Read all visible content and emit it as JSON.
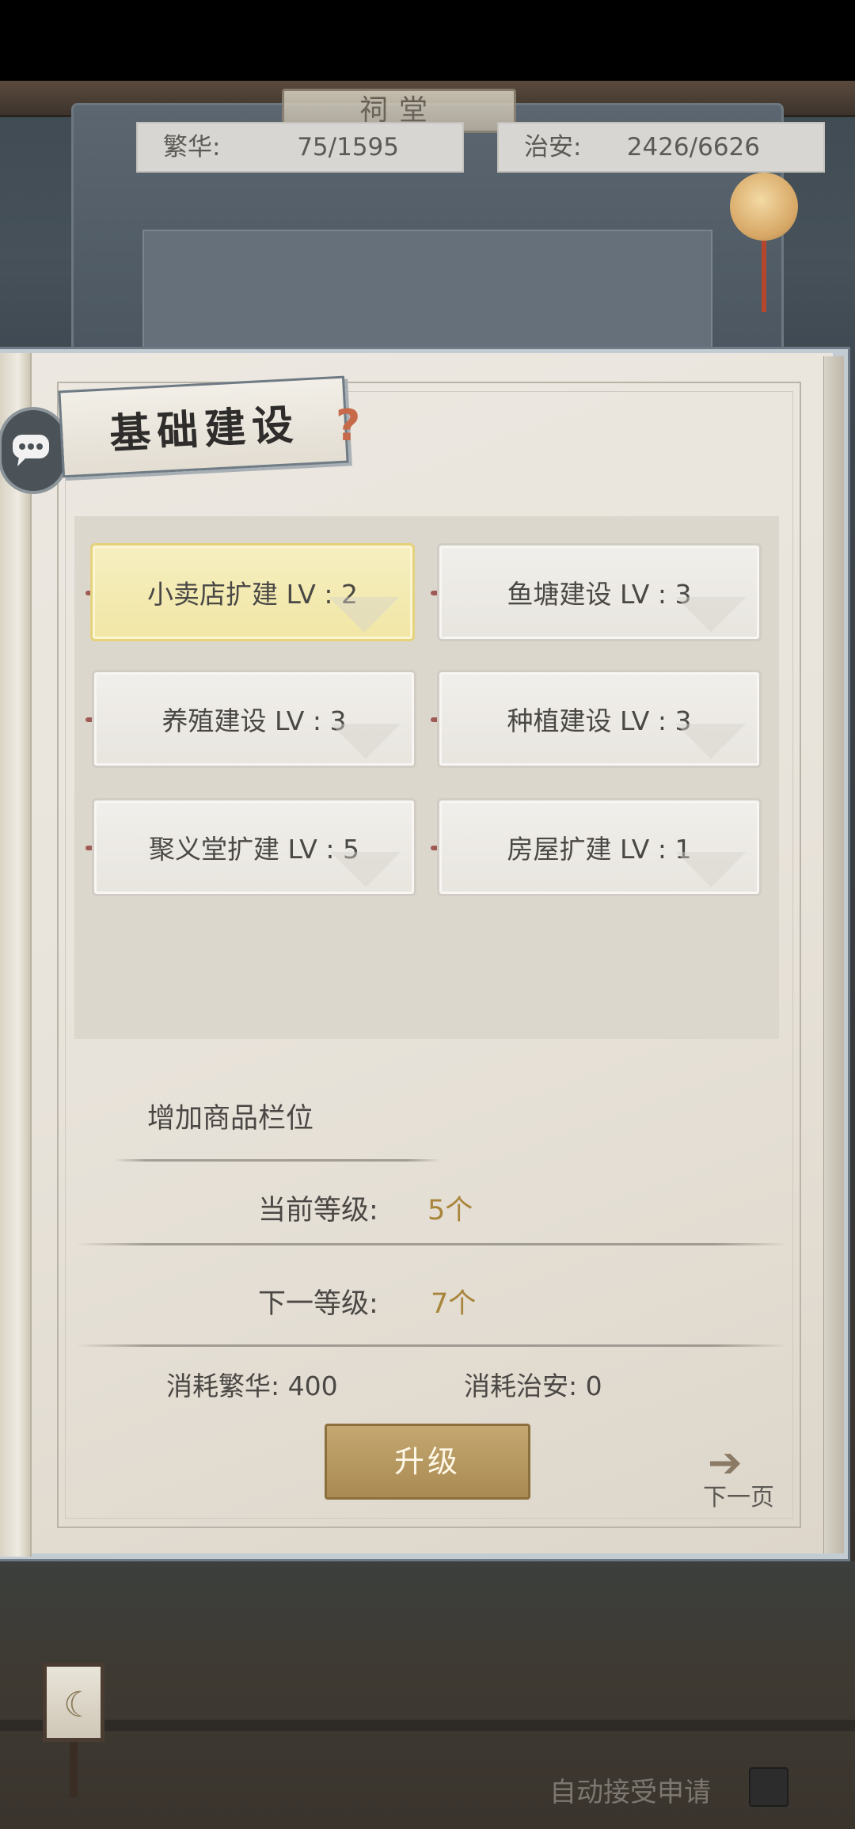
{
  "stats": {
    "prosperity_label": "繁华:",
    "prosperity_value": "75/1595",
    "security_label": "治安:",
    "security_value": "2426/6626"
  },
  "hall_sign": "祠堂",
  "panel": {
    "title": "基础建设",
    "help_icon": "?"
  },
  "buildings": [
    {
      "label": "小卖店扩建 LV : 2",
      "selected": true
    },
    {
      "label": "鱼塘建设 LV : 3",
      "selected": false
    },
    {
      "label": "养殖建设 LV : 3",
      "selected": false
    },
    {
      "label": "种植建设 LV : 3",
      "selected": false
    },
    {
      "label": "聚义堂扩建 LV : 5",
      "selected": false
    },
    {
      "label": "房屋扩建 LV : 1",
      "selected": false
    }
  ],
  "detail": {
    "description": "增加商品栏位",
    "current_level_label": "当前等级:",
    "current_level_value": "5个",
    "next_level_label": "下一等级:",
    "next_level_value": "7个",
    "cost_prosperity": "消耗繁华: 400",
    "cost_security": "消耗治安: 0"
  },
  "actions": {
    "upgrade_label": "升级",
    "next_page_label": "下一页",
    "auto_accept_label": "自动接受申请"
  },
  "icons": {
    "chat": "chat-bubble-icon",
    "next_arrow": "arrow-right-icon",
    "lamp": "lantern-icon"
  },
  "colors": {
    "accent_gold": "#a8853a",
    "selected_card": "#f3eab0",
    "button": "#b89a60"
  }
}
